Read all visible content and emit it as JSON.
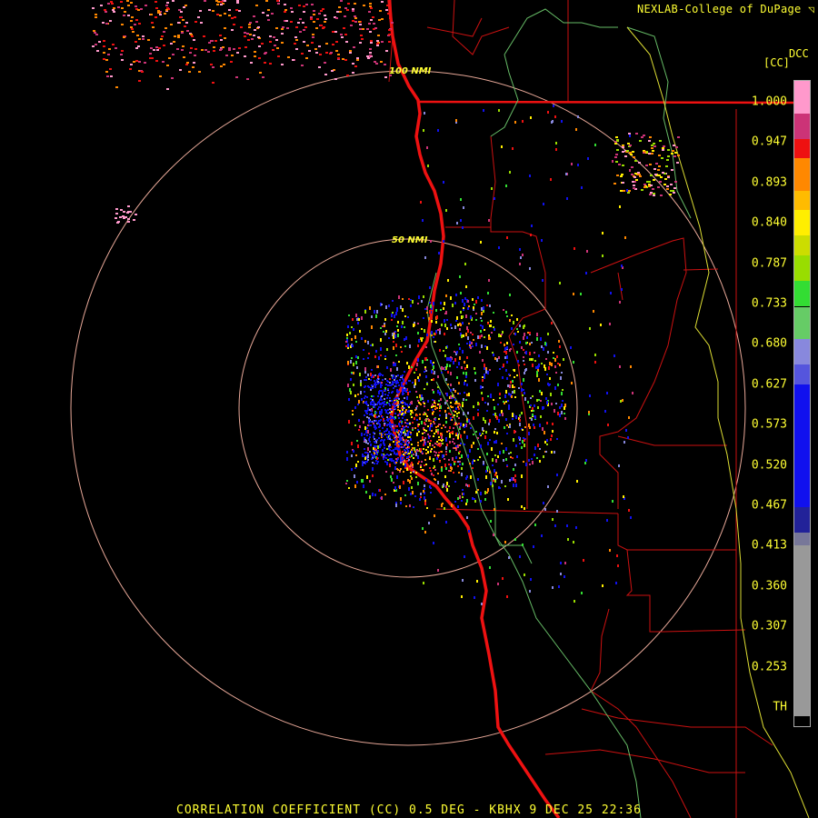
{
  "credit": "NEXLAB-College of DuPage",
  "credit_icon": "logo-icon",
  "colorbar": {
    "product": "DCC",
    "unit": "[CC]",
    "ticks": [
      "1.000",
      "0.947",
      "0.893",
      "0.840",
      "0.787",
      "0.733",
      "0.680",
      "0.627",
      "0.573",
      "0.520",
      "0.467",
      "0.413",
      "0.360",
      "0.307",
      "0.253",
      "TH"
    ],
    "colors": {
      "pink": "#ff99cc",
      "magenta": "#cc3377",
      "red": "#ee1111",
      "orange": "#ff8800",
      "yellow": "#ffee00",
      "lime": "#99dd00",
      "green": "#33dd33",
      "lavender": "#8888dd",
      "blue": "#1111ee",
      "navy": "#222299",
      "gray": "#999999",
      "black": "#000000"
    }
  },
  "range_rings": {
    "inner_label": "50 NMI",
    "outer_label": "100 NMI"
  },
  "footer": "CORRELATION COEFFICIENT (CC) 0.5 DEG - KBHX 9 DEC 25 22:36"
}
